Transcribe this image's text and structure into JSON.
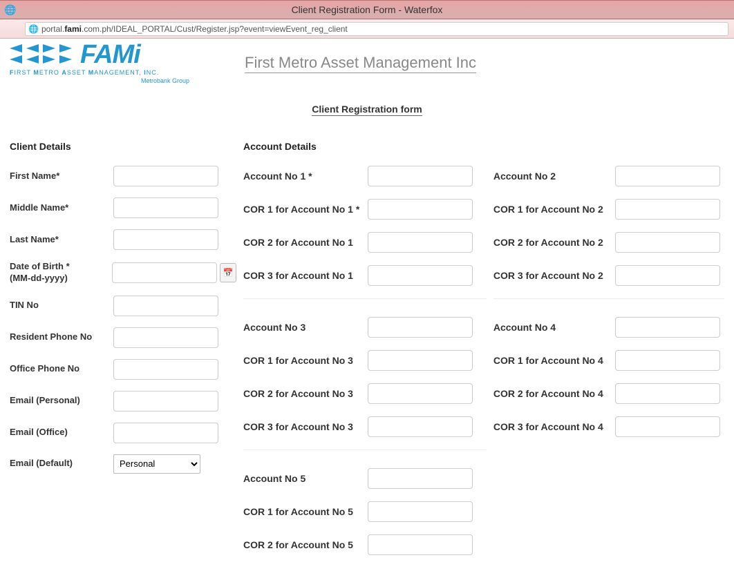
{
  "window": {
    "title": "Client Registration Form - Waterfox"
  },
  "address": {
    "prefix": "portal.",
    "host": "fami",
    "suffix": ".com.ph/IDEAL_PORTAL/Cust/Register.jsp?event=viewEvent_reg_client"
  },
  "logo": {
    "brand": "FAMi",
    "tagline_html": "FIRST METRO ASSET MANAGEMENT, INC.",
    "metrobank": "Metrobank Group"
  },
  "company_title": "First Metro Asset Management Inc",
  "page_subtitle": "Client Registration form",
  "sections": {
    "client": "Client Details",
    "account": "Account Details"
  },
  "client_fields": {
    "first_name": "First Name*",
    "middle_name": "Middle Name*",
    "last_name": "Last Name*",
    "dob": "Date of Birth *\n(MM-dd-yyyy)",
    "tin": "TIN No",
    "res_phone": "Resident Phone No",
    "office_phone": "Office Phone No",
    "email_personal": "Email (Personal)",
    "email_office": "Email (Office)",
    "email_default": "Email (Default)",
    "email_default_value": "Personal"
  },
  "acct": {
    "a1": {
      "no": "Account No 1 *",
      "c1": "COR 1 for Account No 1 *",
      "c2": "COR 2 for Account No 1",
      "c3": "COR 3 for Account No 1"
    },
    "a2": {
      "no": "Account No 2",
      "c1": "COR 1 for Account No 2",
      "c2": "COR 2 for Account No 2",
      "c3": "COR 3 for Account No 2"
    },
    "a3": {
      "no": "Account No 3",
      "c1": "COR 1 for Account No 3",
      "c2": "COR 2 for Account No 3",
      "c3": "COR 3 for Account No 3"
    },
    "a4": {
      "no": "Account No 4",
      "c1": "COR 1 for Account No 4",
      "c2": "COR 2 for Account No 4",
      "c3": "COR 3 for Account No 4"
    },
    "a5": {
      "no": "Account No 5",
      "c1": "COR 1 for Account No 5",
      "c2": "COR 2 for Account No 5"
    }
  }
}
